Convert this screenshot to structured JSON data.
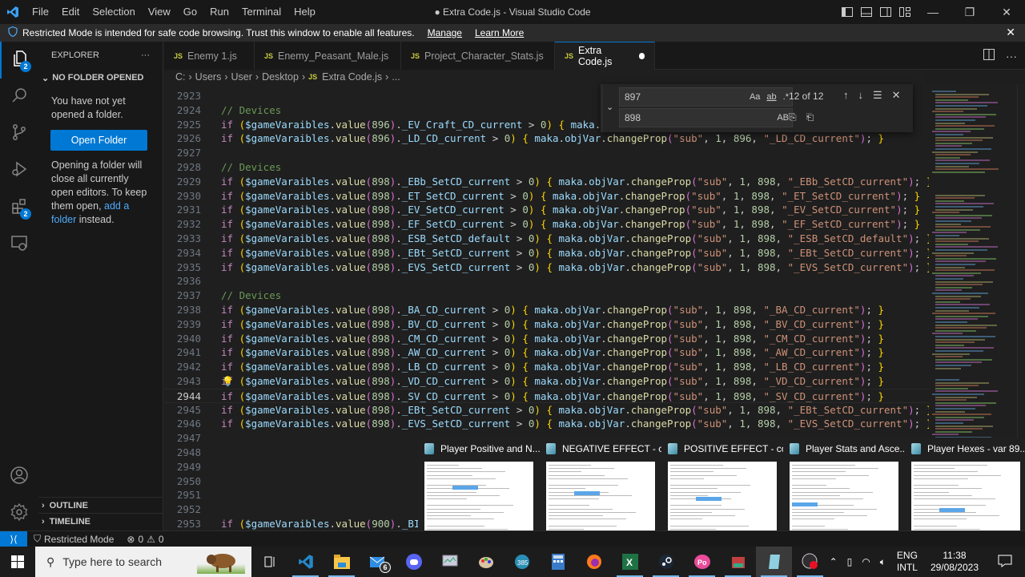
{
  "titlebar": {
    "menu": [
      "File",
      "Edit",
      "Selection",
      "View",
      "Go",
      "Run",
      "Terminal",
      "Help"
    ],
    "title": "● Extra Code.js - Visual Studio Code"
  },
  "banner": {
    "message": "Restricted Mode is intended for safe code browsing. Trust this window to enable all features.",
    "manage": "Manage",
    "learn_more": "Learn More"
  },
  "activity": {
    "explorer_badge": "2",
    "extensions_badge": "2"
  },
  "sidebar": {
    "title": "EXPLORER",
    "section": "NO FOLDER OPENED",
    "msg1": "You have not yet opened a folder.",
    "open_folder": "Open Folder",
    "msg2": "Opening a folder will close all currently open editors. To keep them open,",
    "msg2_link": "add a folder",
    "msg2_end": "instead.",
    "outline": "OUTLINE",
    "timeline": "TIMELINE"
  },
  "tabs": [
    {
      "label": "Enemy 1.js",
      "dirty": false
    },
    {
      "label": "Enemy_Peasant_Male.js",
      "dirty": false
    },
    {
      "label": "Project_Character_Stats.js",
      "dirty": true
    },
    {
      "label": "Extra Code.js",
      "dirty": true,
      "active": true
    }
  ],
  "breadcrumb": [
    "C:",
    "Users",
    "User",
    "Desktop",
    "Extra Code.js",
    "..."
  ],
  "find": {
    "search_value": "897",
    "replace_value": "898",
    "match_case": "Aa",
    "whole_word": "ab",
    "regex": ".*",
    "preserve_case": "AB",
    "result_count": "12 of 12"
  },
  "editor": {
    "current_line": 2944,
    "lines": [
      {
        "n": 2923,
        "type": "blank"
      },
      {
        "n": 2924,
        "type": "comment",
        "text": "// Devices"
      },
      {
        "n": 2925,
        "type": "if",
        "var": "896",
        "prop": "_EV_Craft_CD_current",
        "truncated": true
      },
      {
        "n": 2926,
        "type": "if",
        "var": "896",
        "prop": "_LD_CD_current"
      },
      {
        "n": 2927,
        "type": "blank"
      },
      {
        "n": 2928,
        "type": "comment",
        "text": "// Devices"
      },
      {
        "n": 2929,
        "type": "if",
        "var": "898",
        "prop": "_EBb_SetCD_current"
      },
      {
        "n": 2930,
        "type": "if",
        "var": "898",
        "prop": "_ET_SetCD_current"
      },
      {
        "n": 2931,
        "type": "if",
        "var": "898",
        "prop": "_EV_SetCD_current"
      },
      {
        "n": 2932,
        "type": "if",
        "var": "898",
        "prop": "_EF_SetCD_current"
      },
      {
        "n": 2933,
        "type": "if",
        "var": "898",
        "prop": "_ESB_SetCD_default"
      },
      {
        "n": 2934,
        "type": "if",
        "var": "898",
        "prop": "_EBt_SetCD_current"
      },
      {
        "n": 2935,
        "type": "if",
        "var": "898",
        "prop": "_EVS_SetCD_current"
      },
      {
        "n": 2936,
        "type": "blank"
      },
      {
        "n": 2937,
        "type": "comment",
        "text": "// Devices"
      },
      {
        "n": 2938,
        "type": "if",
        "var": "898",
        "prop": "_BA_CD_current"
      },
      {
        "n": 2939,
        "type": "if",
        "var": "898",
        "prop": "_BV_CD_current"
      },
      {
        "n": 2940,
        "type": "if",
        "var": "898",
        "prop": "_CM_CD_current"
      },
      {
        "n": 2941,
        "type": "if",
        "var": "898",
        "prop": "_AW_CD_current"
      },
      {
        "n": 2942,
        "type": "if",
        "var": "898",
        "prop": "_LB_CD_current"
      },
      {
        "n": 2943,
        "type": "if",
        "var": "898",
        "prop": "_VD_CD_current",
        "bulb": true
      },
      {
        "n": 2944,
        "type": "if",
        "var": "898",
        "prop": "_SV_CD_current"
      },
      {
        "n": 2945,
        "type": "if",
        "var": "898",
        "prop": "_EBt_SetCD_current"
      },
      {
        "n": 2946,
        "type": "if",
        "var": "898",
        "prop": "_EVS_SetCD_current"
      },
      {
        "n": 2947,
        "type": "blank"
      },
      {
        "n": 2948,
        "type": "blank"
      },
      {
        "n": 2949,
        "type": "blank"
      },
      {
        "n": 2950,
        "type": "blank"
      },
      {
        "n": 2951,
        "type": "blank"
      },
      {
        "n": 2952,
        "type": "blank"
      },
      {
        "n": 2953,
        "type": "partial",
        "var": "900",
        "prop": "_BI_"
      }
    ]
  },
  "previews": [
    {
      "title": "Player Positive and N..."
    },
    {
      "title": "NEGATIVE EFFECT - c..."
    },
    {
      "title": "POSITIVE EFFECT - co..."
    },
    {
      "title": "Player Stats and Asce..."
    },
    {
      "title": "Player Hexes - var 89..."
    }
  ],
  "statusbar": {
    "restricted": "Restricted Mode",
    "errors": "0",
    "warnings": "0"
  },
  "taskbar": {
    "search_placeholder": "Type here to search",
    "mail_badge": "6",
    "lang1": "ENG",
    "lang2": "INTL",
    "time": "11:38",
    "date": "29/08/2023"
  }
}
